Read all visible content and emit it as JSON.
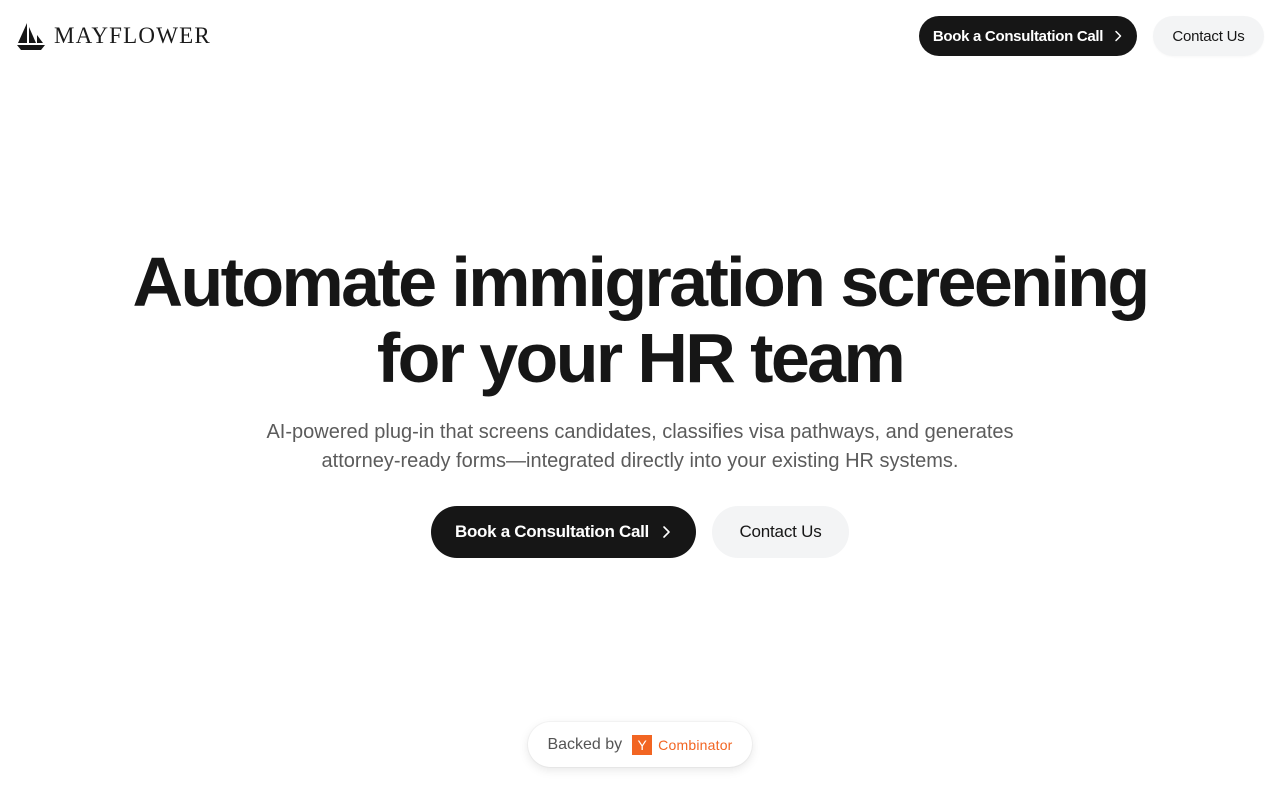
{
  "header": {
    "logo_text": "MAYFLOWER",
    "logo_icon": "ship-icon",
    "primary_button": "Book a Consultation Call",
    "secondary_button": "Contact Us"
  },
  "hero": {
    "title_line1": "Automate immigration screening",
    "title_line2": "for your HR team",
    "subtitle_line1": "AI-powered plug-in that screens candidates, classifies visa pathways, and generates",
    "subtitle_line2": "attorney-ready forms—integrated directly into your existing HR systems.",
    "primary_button": "Book a Consultation Call",
    "secondary_button": "Contact Us"
  },
  "badge": {
    "label": "Backed by",
    "yc_letter": "Y",
    "yc_name": "Combinator"
  },
  "colors": {
    "primary": "#161616",
    "secondary_bg": "#f3f4f5",
    "text_muted": "#5b5b5b",
    "yc_orange": "#f26522"
  }
}
